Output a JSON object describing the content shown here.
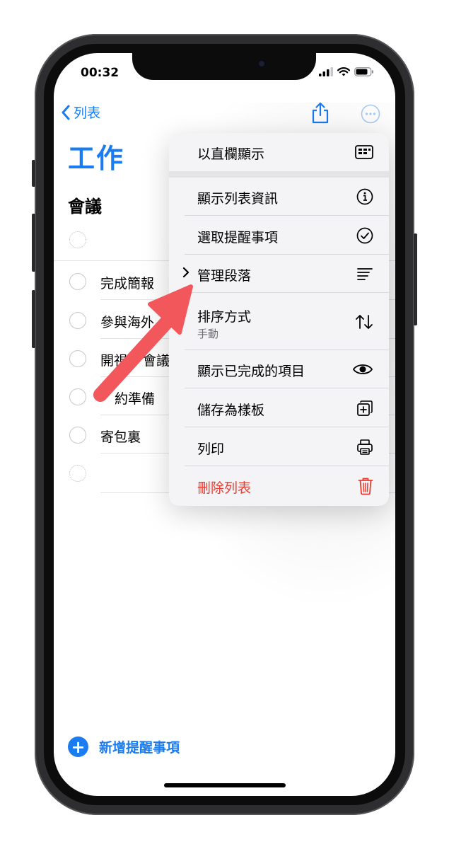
{
  "status_bar": {
    "time": "00:32"
  },
  "nav": {
    "back_label": "列表"
  },
  "list": {
    "title": "工作",
    "section_title": "會議",
    "items": [
      "完成簡報",
      "參與海外",
      "開視",
      "會議",
      "約準備",
      "寄包裏"
    ]
  },
  "menu": {
    "items": [
      {
        "label": "以直欄顯示",
        "icon": "columns-icon"
      },
      {
        "label": "顯示列表資訊",
        "icon": "info-icon"
      },
      {
        "label": "選取提醒事項",
        "icon": "checkmark-circle-icon"
      },
      {
        "label": "管理段落",
        "icon": "paragraph-lines-icon"
      },
      {
        "label": "排序方式",
        "sublabel": "手動",
        "icon": "sort-arrows-icon"
      },
      {
        "label": "顯示已完成的項目",
        "icon": "eye-icon"
      },
      {
        "label": "儲存為樣板",
        "icon": "add-template-icon"
      },
      {
        "label": "列印",
        "icon": "printer-icon"
      },
      {
        "label": "刪除列表",
        "icon": "trash-icon"
      }
    ]
  },
  "footer": {
    "add_label": "新增提醒事項",
    "add_symbol": "+"
  },
  "colors": {
    "accent": "#1a7cf0",
    "destructive": "#eb3b30",
    "annotation_arrow": "#f2575c"
  }
}
